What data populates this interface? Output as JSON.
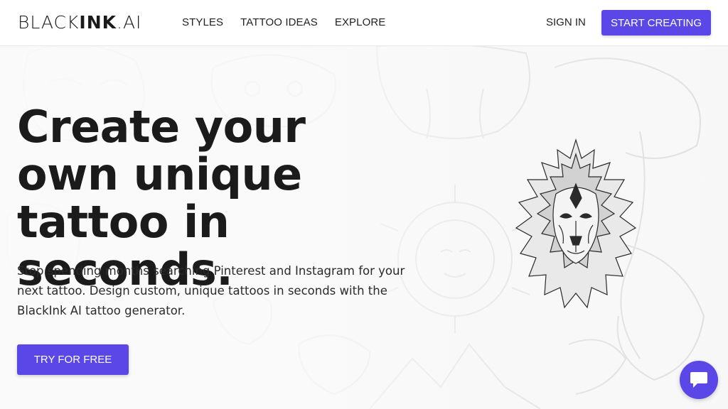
{
  "header": {
    "logo": {
      "part1": "BLACK",
      "part2": "INK",
      "part3": ".AI"
    },
    "nav": [
      {
        "label": "STYLES"
      },
      {
        "label": "TATTOO IDEAS"
      },
      {
        "label": "EXPLORE"
      }
    ],
    "sign_in": "SIGN IN",
    "start_creating": "START CREATING"
  },
  "hero": {
    "headline": "Create your own unique tattoo in seconds.",
    "subtext": "Stop spending months searching Pinterest and Instagram for your next tattoo. Design custom, unique tattoos in seconds with the BlackInk AI tattoo generator.",
    "cta": "TRY FOR FREE"
  },
  "theme": {
    "accent": "#5b47e8",
    "text": "#1b1b1b",
    "background": "#f7f7f7"
  },
  "icons": {
    "chat": "chat-bubble-icon",
    "lion": "lion-tattoo-illustration"
  }
}
